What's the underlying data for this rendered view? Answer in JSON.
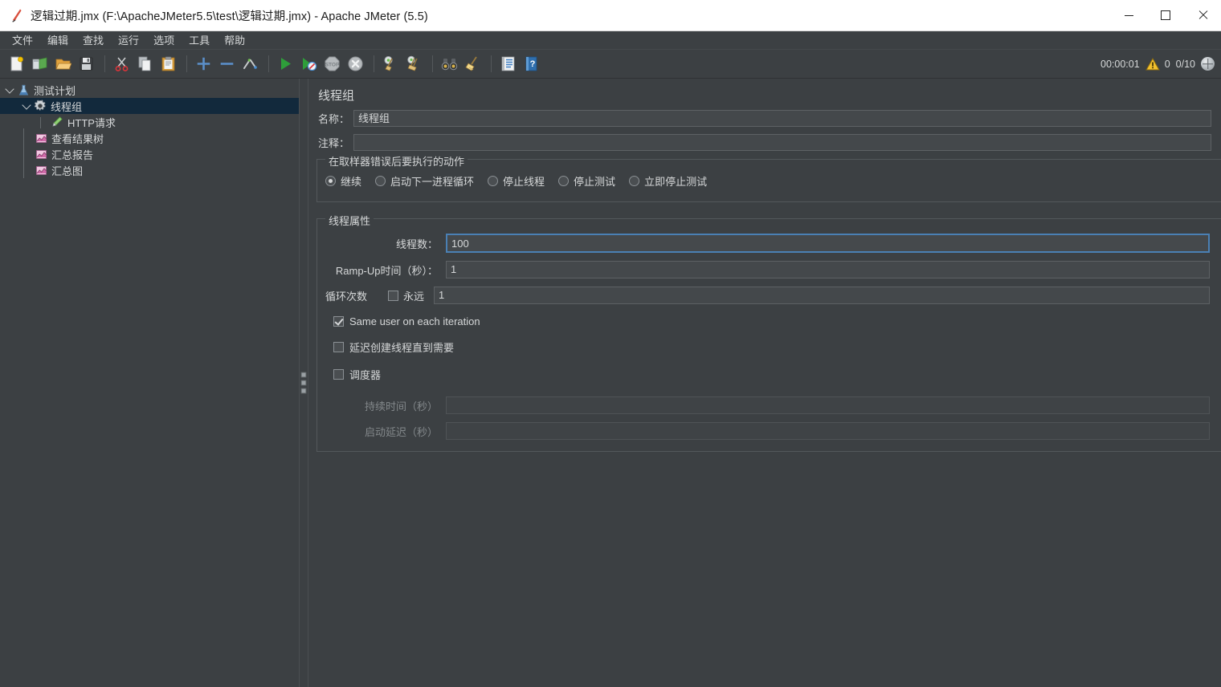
{
  "window": {
    "title": "逻辑过期.jmx (F:\\ApacheJMeter5.5\\test\\逻辑过期.jmx) - Apache JMeter (5.5)",
    "app_icon": "jmeter-feather-icon",
    "minimize_label": "最小化",
    "maximize_label": "最大化",
    "close_label": "关闭"
  },
  "menubar": {
    "items": [
      {
        "label": "文件",
        "name": "menu-file"
      },
      {
        "label": "编辑",
        "name": "menu-edit"
      },
      {
        "label": "查找",
        "name": "menu-search"
      },
      {
        "label": "运行",
        "name": "menu-run"
      },
      {
        "label": "选项",
        "name": "menu-options"
      },
      {
        "label": "工具",
        "name": "menu-tools"
      },
      {
        "label": "帮助",
        "name": "menu-help"
      }
    ]
  },
  "toolbar": {
    "buttons": [
      {
        "icon": "new-document-icon",
        "tooltip": "新建"
      },
      {
        "icon": "templates-icon",
        "tooltip": "模板"
      },
      {
        "icon": "open-folder-icon",
        "tooltip": "打开"
      },
      {
        "icon": "save-floppy-icon",
        "tooltip": "保存"
      },
      {
        "icon": "cut-scissors-icon",
        "tooltip": "剪切"
      },
      {
        "icon": "copy-icon",
        "tooltip": "复制"
      },
      {
        "icon": "paste-clipboard-icon",
        "tooltip": "粘贴"
      },
      {
        "icon": "expand-plus-icon",
        "tooltip": "展开全部"
      },
      {
        "icon": "collapse-minus-icon",
        "tooltip": "收起全部"
      },
      {
        "icon": "toggle-enable-icon",
        "tooltip": "切换"
      },
      {
        "icon": "start-play-icon",
        "tooltip": "启动"
      },
      {
        "icon": "start-no-pauses-icon",
        "tooltip": "无暂停启动"
      },
      {
        "icon": "stop-icon",
        "tooltip": "停止"
      },
      {
        "icon": "shutdown-icon",
        "tooltip": "关闭"
      },
      {
        "icon": "clear-broom-icon",
        "tooltip": "清除"
      },
      {
        "icon": "clear-all-broom-icon",
        "tooltip": "清除全部"
      },
      {
        "icon": "search-binoculars-icon",
        "tooltip": "查找"
      },
      {
        "icon": "reset-search-broom-icon",
        "tooltip": "重置查找"
      },
      {
        "icon": "function-helper-icon",
        "tooltip": "函数助手对话框"
      },
      {
        "icon": "help-book-icon",
        "tooltip": "帮助"
      }
    ],
    "status": {
      "elapsed": "00:00:01",
      "warning_icon": "warning-triangle-icon",
      "error_count": "0",
      "threads": "0/10",
      "remote_icon": "connection-sphere-icon"
    }
  },
  "tree": {
    "nodes": [
      {
        "label": "测试计划",
        "icon": "test-plan-flask-icon",
        "depth": 0,
        "expanded": true,
        "selected": false
      },
      {
        "label": "线程组",
        "icon": "thread-group-gear-icon",
        "depth": 1,
        "expanded": true,
        "selected": true
      },
      {
        "label": "HTTP请求",
        "icon": "http-request-pen-icon",
        "depth": 2,
        "expanded": null,
        "selected": false
      },
      {
        "label": "查看结果树",
        "icon": "listener-chart-icon",
        "depth": 1,
        "expanded": null,
        "selected": false
      },
      {
        "label": "汇总报告",
        "icon": "listener-chart-icon",
        "depth": 1,
        "expanded": null,
        "selected": false
      },
      {
        "label": "汇总图",
        "icon": "listener-chart-icon",
        "depth": 1,
        "expanded": null,
        "selected": false
      }
    ]
  },
  "panel": {
    "title": "线程组",
    "name_label": "名称：",
    "name_value": "线程组",
    "comment_label": "注释：",
    "comment_value": "",
    "error_action": {
      "group_title": "在取样器错误后要执行的动作",
      "options": [
        {
          "label": "继续",
          "selected": true
        },
        {
          "label": "启动下一进程循环",
          "selected": false
        },
        {
          "label": "停止线程",
          "selected": false
        },
        {
          "label": "停止测试",
          "selected": false
        },
        {
          "label": "立即停止测试",
          "selected": false
        }
      ]
    },
    "thread_properties": {
      "group_title": "线程属性",
      "threads_label": "线程数：",
      "threads_value": "100",
      "threads_focused": true,
      "rampup_label": "Ramp-Up时间（秒）：",
      "rampup_value": "1",
      "loops_label": "循环次数",
      "forever_label": "永远",
      "forever_checked": false,
      "loops_value": "1",
      "same_user_label": "Same user on each iteration",
      "same_user_checked": true,
      "delayed_start_label": "延迟创建线程直到需要",
      "delayed_start_checked": false,
      "scheduler_label": "调度器",
      "scheduler_checked": false,
      "duration_label": "持续时间（秒）",
      "duration_value": "",
      "duration_disabled": true,
      "startup_delay_label": "启动延迟（秒）",
      "startup_delay_value": "",
      "startup_delay_disabled": true
    }
  },
  "colors": {
    "background": "#3c4043",
    "selection": "#12293c",
    "field": "#44484b",
    "focus_border": "#4a80b4",
    "text": "#d6d8d9",
    "text_dim": "#83888b"
  }
}
